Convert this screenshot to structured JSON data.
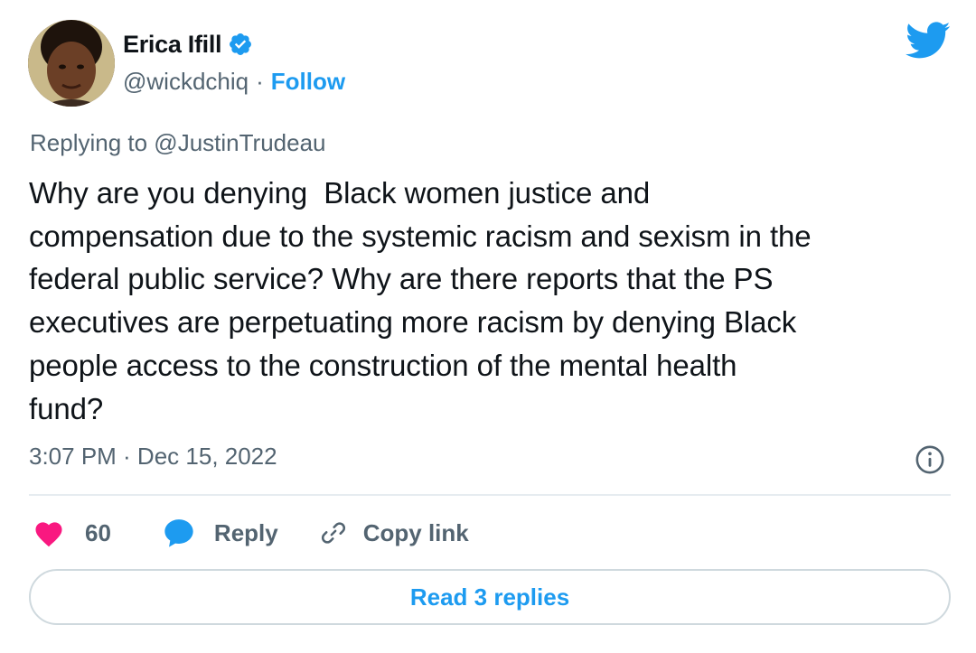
{
  "author": {
    "display_name": "Erica Ifill",
    "handle": "@wickdchiq",
    "separator": "·",
    "follow_label": "Follow",
    "verified": true
  },
  "tweet": {
    "replying_to": "Replying to @JustinTrudeau",
    "text": "Why are you denying  Black women justice and\ncompensation due to the systemic racism and sexism in the\nfederal public service? Why are there reports that the PS\nexecutives are perpetuating more racism by denying Black\npeople access to the construction of the mental health\nfund?",
    "timestamp": "3:07 PM · Dec 15, 2022"
  },
  "actions": {
    "like_count": "60",
    "reply_label": "Reply",
    "copy_link_label": "Copy link"
  },
  "footer": {
    "read_replies_label": "Read 3 replies"
  },
  "icons": {
    "brand": "twitter-bird-icon",
    "verified": "verified-badge-icon",
    "info": "info-icon",
    "like": "heart-icon",
    "reply": "speech-bubble-icon",
    "copy_link": "link-icon"
  },
  "colors": {
    "accent": "#1d9bf0",
    "like": "#f91880",
    "muted_text": "#536471",
    "body_text": "#0f1419",
    "border": "#cfd9de"
  }
}
